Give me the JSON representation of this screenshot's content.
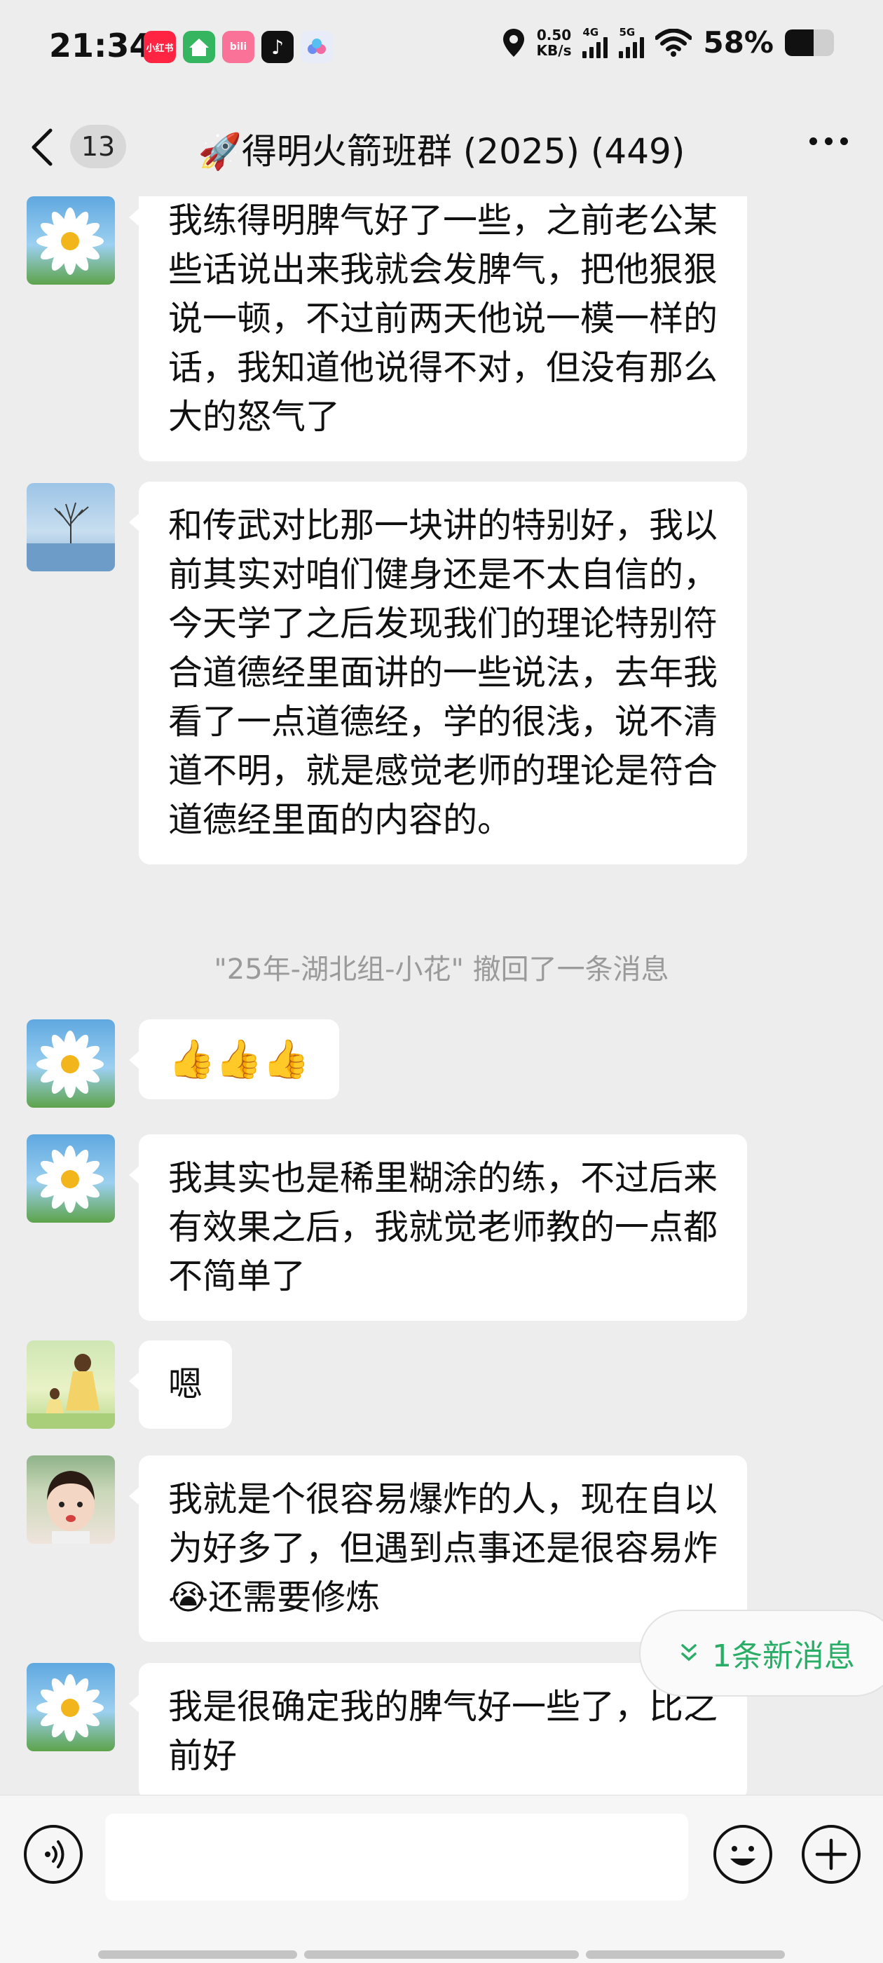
{
  "status_bar": {
    "time": "21:34",
    "app_icons": [
      {
        "name": "xiaohongshu-icon",
        "label": "小红书",
        "color": "#ff2442"
      },
      {
        "name": "home-app-icon",
        "label": "",
        "color": "#35b560"
      },
      {
        "name": "bilibili-icon",
        "label": "bili",
        "color": "#fb7299"
      },
      {
        "name": "tiktok-icon",
        "label": "♪",
        "color": "#111111"
      },
      {
        "name": "cloud-app-icon",
        "label": "",
        "color": "#e8ecf8"
      }
    ],
    "net_speed_value": "0.50",
    "net_speed_unit": "KB/s",
    "signal_1_label": "4G",
    "signal_2_label": "5G",
    "battery_percent": "58%",
    "battery_level": 0.58
  },
  "nav": {
    "unread_count": "13",
    "title": "🚀得明火箭班群 (2025) (449)"
  },
  "messages": [
    {
      "type": "text",
      "avatar": "daisy-avatar",
      "text": "我练得明脾气好了一些，之前老公某些话说出来我就会发脾气，把他狠狠说一顿，不过前两天他说一模一样的话，我知道他说得不对，但没有那么大的怒气了"
    },
    {
      "type": "text",
      "avatar": "tree-avatar",
      "text": "和传武对比那一块讲的特别好，我以前其实对咱们健身还是不太自信的，今天学了之后发现我们的理论特别符合道德经里面讲的一些说法，去年我看了一点道德经，学的很浅，说不清道不明，就是感觉老师的理论是符合道德经里面的内容的。"
    },
    {
      "type": "system",
      "text": "\"25年-湖北组-小花\" 撤回了一条消息"
    },
    {
      "type": "text",
      "avatar": "daisy-avatar",
      "text": "👍👍👍"
    },
    {
      "type": "text",
      "avatar": "daisy-avatar",
      "text": "我其实也是稀里糊涂的练，不过后来有效果之后，我就觉老师教的一点都不简单了"
    },
    {
      "type": "text",
      "avatar": "field-avatar",
      "text": "嗯"
    },
    {
      "type": "text",
      "avatar": "girl-avatar",
      "text": "我就是个很容易爆炸的人，现在自以为好多了，但遇到点事还是很容易炸😭还需要修炼"
    },
    {
      "type": "text",
      "avatar": "daisy-avatar",
      "text": "我是很确定我的脾气好一些了，比之前好"
    }
  ],
  "new_message_pill": "1条新消息",
  "input": {
    "value": "",
    "placeholder": ""
  }
}
